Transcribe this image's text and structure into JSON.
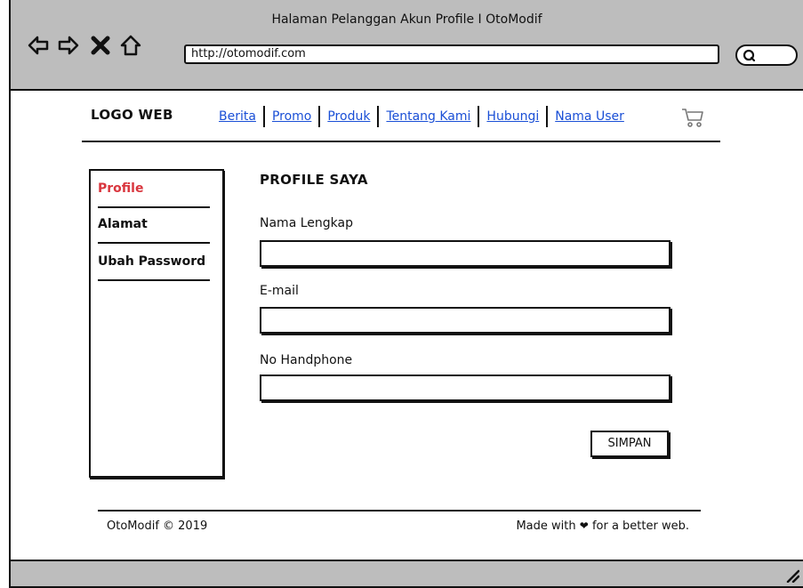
{
  "window": {
    "title": "Halaman Pelanggan Akun Profile I OtoModif",
    "url": "http://otomodif.com",
    "icons": [
      "back-arrow-icon",
      "forward-arrow-icon",
      "close-x-icon",
      "home-icon",
      "search-icon",
      "cart-icon",
      "resize-grip-icon"
    ]
  },
  "header": {
    "logo": "LOGO WEB",
    "menu": [
      "Berita",
      "Promo",
      "Produk",
      "Tentang Kami",
      "Hubungi",
      "Nama User"
    ]
  },
  "sidebar": {
    "items": [
      {
        "label": "Profile",
        "active": true
      },
      {
        "label": "Alamat",
        "active": false
      },
      {
        "label": "Ubah Password",
        "active": false
      }
    ],
    "active_color": "#d9363e"
  },
  "form": {
    "title": "PROFILE SAYA",
    "fields": [
      {
        "label": "Nama Lengkap",
        "value": ""
      },
      {
        "label": "E-mail",
        "value": ""
      },
      {
        "label": "No Handphone",
        "value": ""
      }
    ],
    "submit_label": "SIMPAN"
  },
  "footer": {
    "copyright": "OtoModif © 2019",
    "made_with_prefix": "Made with",
    "made_with_suffix": "for a better web."
  },
  "colors": {
    "link": "#1a4fd6",
    "chrome": "#bdbdbd"
  }
}
